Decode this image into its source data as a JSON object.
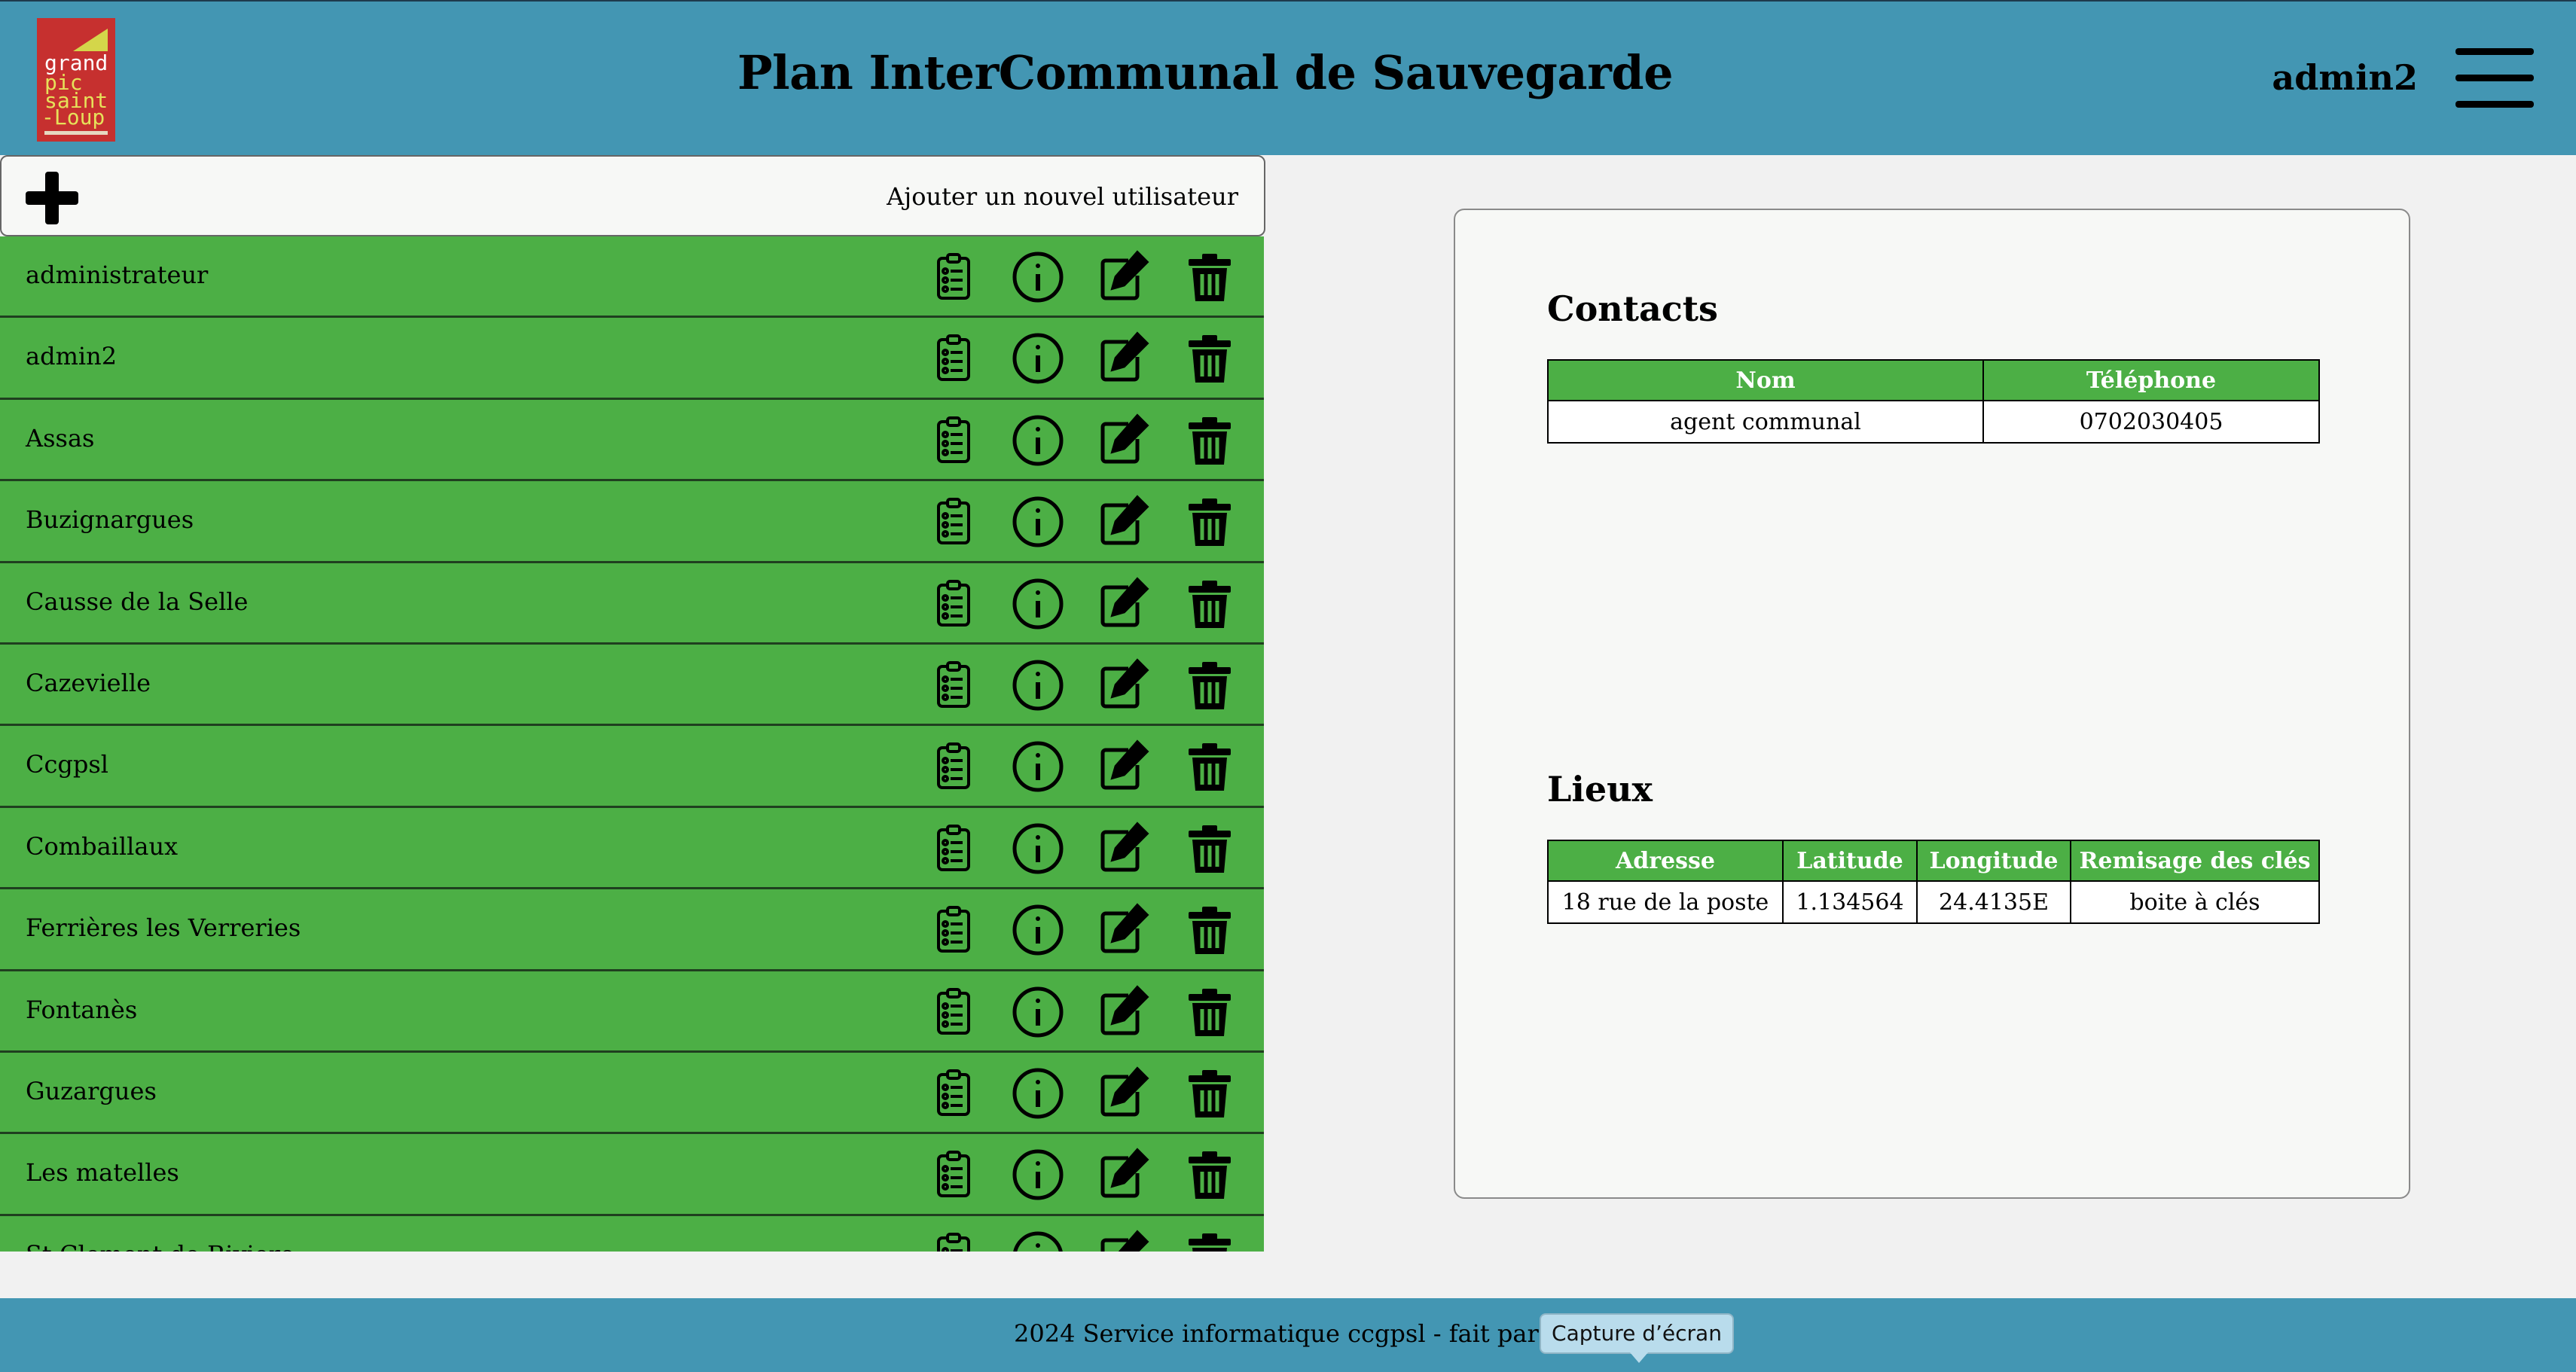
{
  "header": {
    "logo_lines": [
      "grand",
      "pic",
      "saint",
      "-Loup"
    ],
    "title": "Plan InterCommunal de Sauvegarde",
    "username": "admin2"
  },
  "toolbar": {
    "add_user_label": "Ajouter un nouvel utilisateur"
  },
  "users": [
    {
      "name": "administrateur"
    },
    {
      "name": "admin2"
    },
    {
      "name": "Assas"
    },
    {
      "name": "Buzignargues"
    },
    {
      "name": "Causse de la Selle"
    },
    {
      "name": "Cazevielle"
    },
    {
      "name": "Ccgpsl"
    },
    {
      "name": "Combaillaux"
    },
    {
      "name": "Ferrières les Verreries"
    },
    {
      "name": "Fontanès"
    },
    {
      "name": "Guzargues"
    },
    {
      "name": "Les matelles"
    },
    {
      "name": "St Clement de Riviere"
    }
  ],
  "details": {
    "contacts": {
      "title": "Contacts",
      "headers": [
        "Nom",
        "Téléphone"
      ],
      "rows": [
        [
          "agent communal",
          "0702030405"
        ]
      ]
    },
    "places": {
      "title": "Lieux",
      "headers": [
        "Adresse",
        "Latitude",
        "Longitude",
        "Remisage des clés"
      ],
      "rows": [
        [
          "18 rue de la poste",
          "1.134564",
          "24.4135E",
          "boite à clés"
        ]
      ]
    }
  },
  "footer": {
    "text": "2024 Service informatique ccgpsl - fait par Rémi Soul",
    "tooltip": "Capture d’écran"
  },
  "colors": {
    "header_bg": "#4396b3",
    "row_green": "#4caf45",
    "logo_red": "#c6302f"
  },
  "icons": [
    "plus-icon",
    "clipboard-list-icon",
    "info-icon",
    "edit-icon",
    "trash-icon",
    "hamburger-menu-icon"
  ]
}
